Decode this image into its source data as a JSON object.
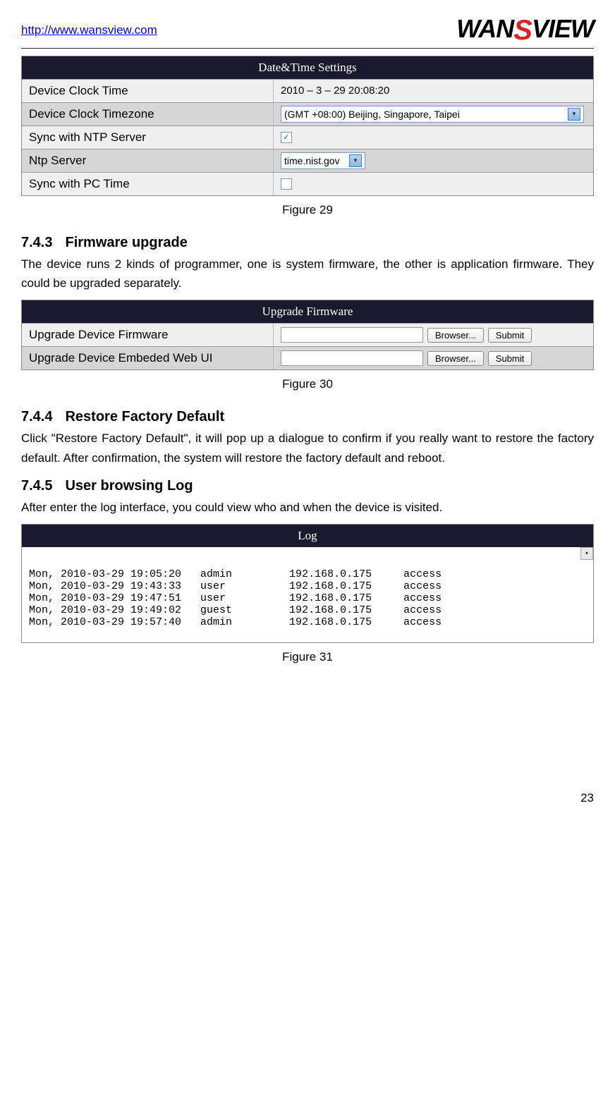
{
  "header": {
    "url": "http://www.wansview.com",
    "logo_wan": "WAN",
    "logo_s": "S",
    "logo_view": "VIEW"
  },
  "datetime_panel": {
    "title": "Date&Time  Settings",
    "rows": [
      {
        "label": "Device Clock Time",
        "value": "2010 – 3 – 29     20:08:20"
      },
      {
        "label": "Device Clock Timezone",
        "value": "(GMT +08:00) Beijing, Singapore, Taipei"
      },
      {
        "label": "Sync with NTP Server",
        "checked": "✓"
      },
      {
        "label": "Ntp Server",
        "value": "time.nist.gov"
      },
      {
        "label": "Sync with PC Time",
        "checked": ""
      }
    ]
  },
  "fig29": "Figure 29",
  "section743": {
    "num": "7.4.3",
    "title": "Firmware upgrade",
    "text": "The device runs 2 kinds of programmer, one is system firmware, the other is application firmware. They could be upgraded separately."
  },
  "upgrade_panel": {
    "title": "Upgrade Firmware",
    "rows": [
      {
        "label": "Upgrade Device Firmware",
        "browse": "Browser...",
        "submit": "Submit"
      },
      {
        "label": "Upgrade Device Embeded Web UI",
        "browse": "Browser...",
        "submit": "Submit"
      }
    ]
  },
  "fig30": "Figure 30",
  "section744": {
    "num": "7.4.4",
    "title": "Restore Factory Default",
    "text": "Click \"Restore Factory Default\", it will pop up a dialogue to confirm if you really want to restore the factory default. After confirmation, the system will restore the factory default and reboot."
  },
  "section745": {
    "num": "7.4.5",
    "title": "User browsing Log",
    "text": "After enter the log interface, you could view who and when the device is visited."
  },
  "log_panel": {
    "title": "Log",
    "lines": [
      "Mon, 2010-03-29 19:05:20   admin         192.168.0.175     access",
      "Mon, 2010-03-29 19:43:33   user          192.168.0.175     access",
      "Mon, 2010-03-29 19:47:51   user          192.168.0.175     access",
      "Mon, 2010-03-29 19:49:02   guest         192.168.0.175     access",
      "Mon, 2010-03-29 19:57:40   admin         192.168.0.175     access"
    ]
  },
  "fig31": "Figure 31",
  "page_num": "23"
}
